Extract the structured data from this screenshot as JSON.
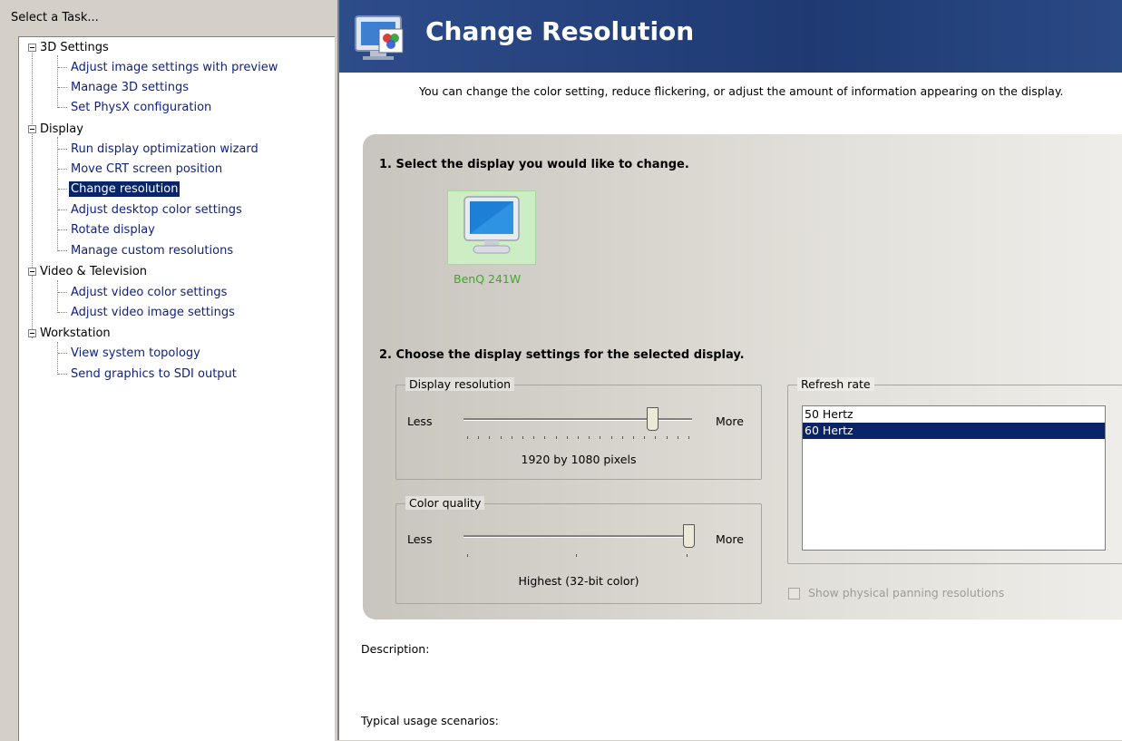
{
  "task_pane": {
    "header": "Select a Task...",
    "groups": [
      {
        "label": "3D Settings",
        "items": [
          "Adjust image settings with preview",
          "Manage 3D settings",
          "Set PhysX configuration"
        ]
      },
      {
        "label": "Display",
        "items": [
          "Run display optimization wizard",
          "Move CRT screen position",
          "Change resolution",
          "Adjust desktop color settings",
          "Rotate display",
          "Manage custom resolutions"
        ]
      },
      {
        "label": "Video & Television",
        "items": [
          "Adjust video color settings",
          "Adjust video image settings"
        ]
      },
      {
        "label": "Workstation",
        "items": [
          "View system topology",
          "Send graphics to SDI output"
        ]
      }
    ],
    "selected_item": "Change resolution"
  },
  "page": {
    "title": "Change Resolution",
    "intro": "You can change the color setting, reduce flickering, or adjust the amount of information appearing on the display.",
    "step1": "1. Select the display you would like to change.",
    "display_name": "BenQ 241W",
    "step2": "2. Choose the display settings for the selected display.",
    "resolution": {
      "legend": "Display resolution",
      "less": "Less",
      "more": "More",
      "value": "1920 by 1080 pixels",
      "slider_fraction": 0.82
    },
    "color": {
      "legend": "Color quality",
      "less": "Less",
      "more": "More",
      "value": "Highest (32-bit color)",
      "slider_fraction": 1.0
    },
    "refresh": {
      "legend": "Refresh rate",
      "options": [
        "50 Hertz",
        "60 Hertz"
      ],
      "selected": "60 Hertz"
    },
    "paging_checkbox": {
      "label": "Show physical panning resolutions",
      "checked": false,
      "enabled": false
    },
    "description_label": "Description:",
    "usage_label": "Typical usage scenarios:"
  },
  "colors": {
    "banner": "#1f3a73",
    "selection": "#0a246a",
    "link_text": "#0f1f7f",
    "display_label": "#3fa829"
  }
}
